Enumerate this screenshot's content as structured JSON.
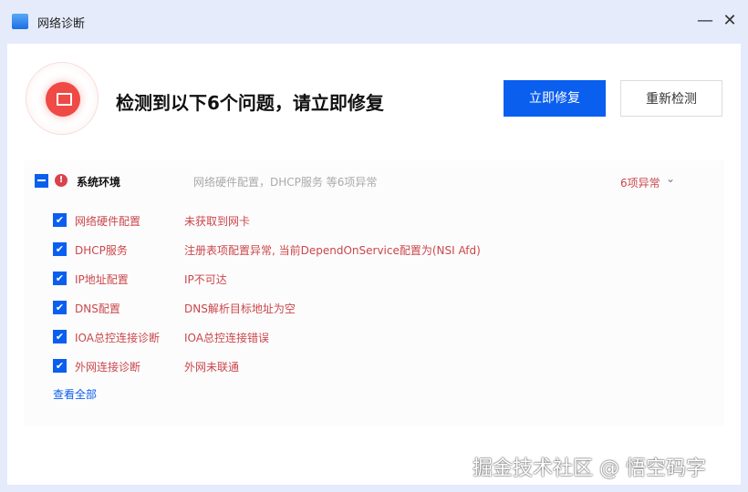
{
  "window": {
    "title": "网络诊断",
    "minimize": "—",
    "close": "✕"
  },
  "header": {
    "headline": "检测到以下6个问题，请立即修复",
    "fix_button": "立即修复",
    "recheck_button": "重新检测"
  },
  "section": {
    "title": "系统环境",
    "summary": "网络硬件配置，DHCP服务 等6项异常",
    "count": "6项异常",
    "chevron": "⌄",
    "warn": "!",
    "items": [
      {
        "name": "网络硬件配置",
        "detail": "未获取到网卡"
      },
      {
        "name": "DHCP服务",
        "detail": "注册表项配置异常, 当前DependOnService配置为(NSI Afd)"
      },
      {
        "name": "IP地址配置",
        "detail": "IP不可达"
      },
      {
        "name": "DNS配置",
        "detail": "DNS解析目标地址为空"
      },
      {
        "name": "IOA总控连接诊断",
        "detail": "IOA总控连接错误"
      },
      {
        "name": "外网连接诊断",
        "detail": "外网未联通"
      }
    ],
    "view_all": "查看全部"
  },
  "watermark": "掘金技术社区 @ 悟空码字"
}
